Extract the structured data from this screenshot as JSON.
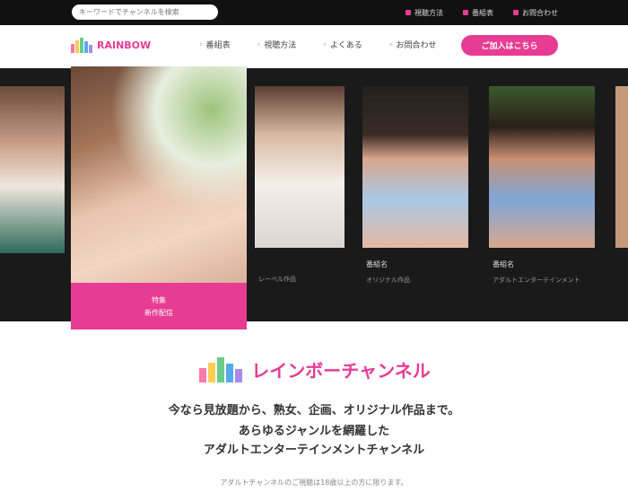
{
  "topbar": {
    "search_placeholder": "キーワードでチャンネルを検索",
    "links": [
      {
        "label": "視聴方法",
        "icon": "square-icon"
      },
      {
        "label": "番組表",
        "icon": "square-icon"
      },
      {
        "label": "お問合わせ",
        "icon": "square-icon"
      }
    ]
  },
  "nav": {
    "logo_text": "RAINBOW",
    "links": [
      {
        "label": "番組表"
      },
      {
        "label": "視聴方法"
      },
      {
        "label": "よくある"
      },
      {
        "label": "お問合わせ"
      }
    ],
    "cta": "ご加入はこちら"
  },
  "carousel": {
    "cards": [
      {
        "name": "",
        "desc": ""
      },
      {
        "name": "特集",
        "desc": "新作配信"
      },
      {
        "name": "",
        "desc": "レーベル作品"
      },
      {
        "name": "番組名",
        "desc": "オリジナル作品"
      },
      {
        "name": "番組名",
        "desc": "アダルトエンターテインメント"
      }
    ]
  },
  "brand": {
    "logo_text": "レインボーチャンネル",
    "tagline_1": "今なら見放題から、熟女、企画、オリジナル作品まで。",
    "tagline_2": "あらゆるジャンルを網羅した",
    "tagline_3": "アダルトエンターテインメントチャンネル",
    "fine_print": "アダルトチャンネルのご視聴は18歳以上の方に限ります。"
  },
  "colors": {
    "accent": "#e73c93",
    "dark": "#1a1a1a"
  }
}
